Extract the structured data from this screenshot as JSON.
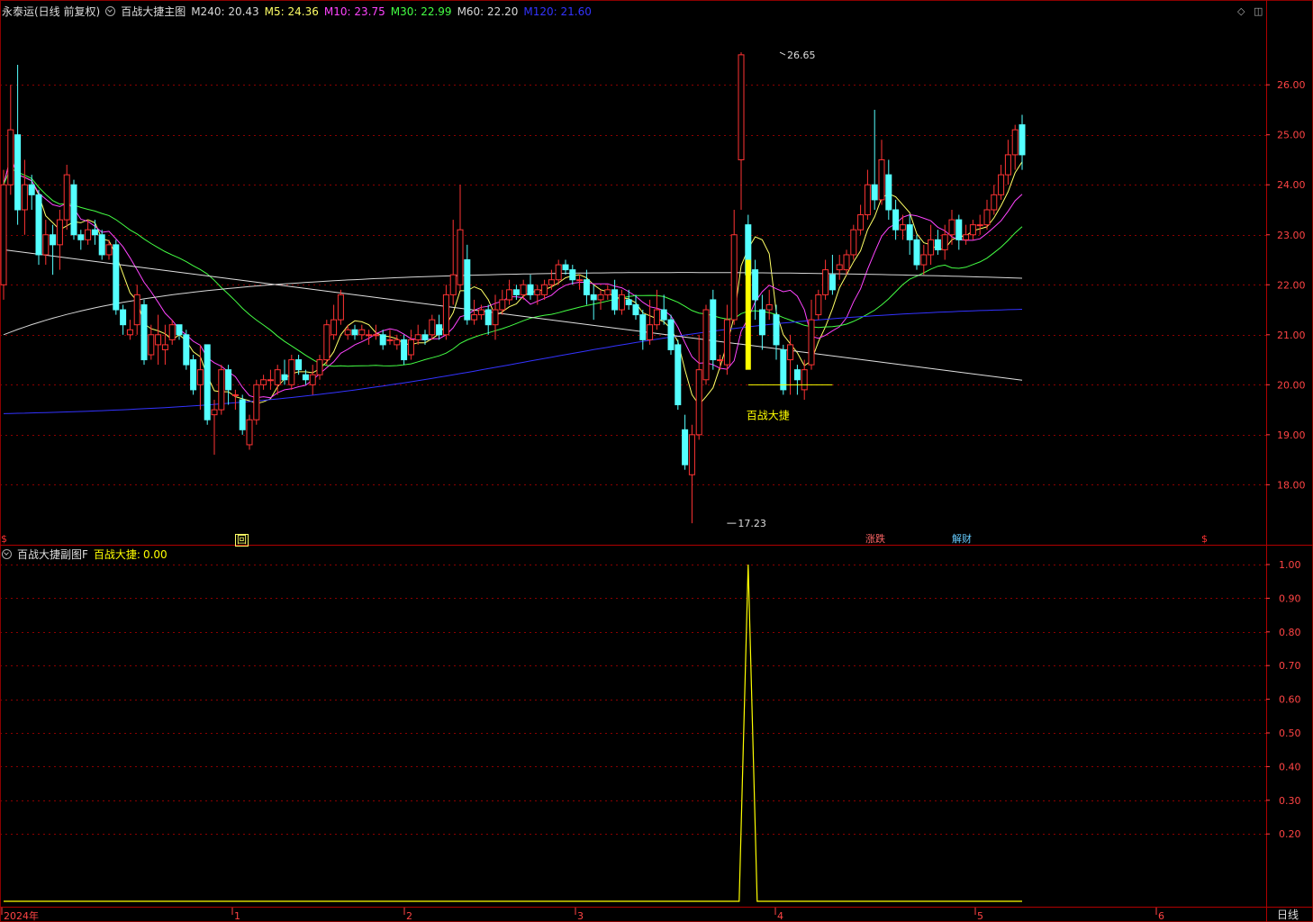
{
  "main_panel": {
    "stock_label": "永泰运(日线 前复权)",
    "indicator_label": "百战大捷主图",
    "ma_readouts": [
      {
        "label": "M240:",
        "value": "20.43",
        "color": "#d8d8d8"
      },
      {
        "label": "M5:",
        "value": "24.36",
        "color": "#ffff66"
      },
      {
        "label": "M10:",
        "value": "23.75",
        "color": "#ff44ff"
      },
      {
        "label": "M30:",
        "value": "22.99",
        "color": "#44ff44"
      },
      {
        "label": "M60:",
        "value": "22.20",
        "color": "#d8d8d8"
      },
      {
        "label": "M120:",
        "value": "21.60",
        "color": "#3333ff"
      }
    ],
    "signal_label": "百战大捷",
    "high_label": "26.65",
    "low_label": "17.23"
  },
  "event_tags": [
    {
      "text": "$",
      "color": "#ff3333"
    },
    {
      "text": "回",
      "color": "#ffff66"
    },
    {
      "text": "涨跌",
      "color": "#ff6666"
    },
    {
      "text": "解财",
      "color": "#66ccff"
    },
    {
      "text": "$",
      "color": "#ff3333"
    }
  ],
  "sub_panel": {
    "title": "百战大捷副图F",
    "readout_label": "百战大捷:",
    "readout_value": "0.00"
  },
  "time_axis": {
    "labels": [
      "2024年",
      "1",
      "2",
      "3",
      "4",
      "5",
      "6"
    ],
    "period": "日线"
  },
  "colors": {
    "up": "#ff3333",
    "down": "#54ffff",
    "grid": "#8b0000",
    "axis_text": "#ff4444",
    "signal": "#ffff00"
  },
  "chart_data": [
    {
      "type": "candlestick",
      "title": "百战大捷主图",
      "ylim": [
        16.8,
        27.3
      ],
      "y_ticks": [
        18.0,
        19.0,
        20.0,
        21.0,
        22.0,
        23.0,
        24.0,
        25.0,
        26.0
      ],
      "candles": [
        [
          22.0,
          24.0,
          21.7,
          24.3
        ],
        [
          24.0,
          25.1,
          23.8,
          26.0
        ],
        [
          25.0,
          23.5,
          23.2,
          26.4
        ],
        [
          23.5,
          24.0,
          23.0,
          24.5
        ],
        [
          24.0,
          23.8,
          23.5,
          24.2
        ],
        [
          23.8,
          22.6,
          22.4,
          23.9
        ],
        [
          22.6,
          23.0,
          22.4,
          23.3
        ],
        [
          23.0,
          22.8,
          22.2,
          23.2
        ],
        [
          22.8,
          23.3,
          22.3,
          23.5
        ],
        [
          23.3,
          24.2,
          23.1,
          24.4
        ],
        [
          24.0,
          23.0,
          22.9,
          24.1
        ],
        [
          23.0,
          22.9,
          22.7,
          23.1
        ],
        [
          22.9,
          23.1,
          22.8,
          23.3
        ],
        [
          23.1,
          23.0,
          22.8,
          23.3
        ],
        [
          23.0,
          22.6,
          22.5,
          23.1
        ],
        [
          22.6,
          22.8,
          22.5,
          22.9
        ],
        [
          22.8,
          21.5,
          21.4,
          22.9
        ],
        [
          21.5,
          21.2,
          21.0,
          21.6
        ],
        [
          21.0,
          21.1,
          20.9,
          21.3
        ],
        [
          21.2,
          21.8,
          21.0,
          22.0
        ],
        [
          21.6,
          20.5,
          20.4,
          21.7
        ],
        [
          20.6,
          21.0,
          20.5,
          21.2
        ],
        [
          20.8,
          21.0,
          20.4,
          21.4
        ],
        [
          20.7,
          20.8,
          20.4,
          21.2
        ],
        [
          20.9,
          21.2,
          20.8,
          21.3
        ],
        [
          21.2,
          21.0,
          20.9,
          21.2
        ],
        [
          21.0,
          20.4,
          20.3,
          21.1
        ],
        [
          20.5,
          19.9,
          19.8,
          20.6
        ],
        [
          20.0,
          20.3,
          19.5,
          20.8
        ],
        [
          20.8,
          19.3,
          19.2,
          20.8
        ],
        [
          19.4,
          19.5,
          18.6,
          19.7
        ],
        [
          19.5,
          20.3,
          19.4,
          20.4
        ],
        [
          20.3,
          19.9,
          19.6,
          20.4
        ],
        [
          19.8,
          19.8,
          19.5,
          19.9
        ],
        [
          19.7,
          19.1,
          19.0,
          19.8
        ],
        [
          18.8,
          19.3,
          18.7,
          19.4
        ],
        [
          19.3,
          20.0,
          19.2,
          20.1
        ],
        [
          20.0,
          20.1,
          19.9,
          20.2
        ],
        [
          20.1,
          20.1,
          19.9,
          20.3
        ],
        [
          20.0,
          20.3,
          19.8,
          20.4
        ],
        [
          20.2,
          20.1,
          20.0,
          20.5
        ],
        [
          20.0,
          20.5,
          19.9,
          20.6
        ],
        [
          20.5,
          20.3,
          20.2,
          20.6
        ],
        [
          20.2,
          20.1,
          20.0,
          20.3
        ],
        [
          20.0,
          20.2,
          19.8,
          20.4
        ],
        [
          20.2,
          20.5,
          20.1,
          20.6
        ],
        [
          20.5,
          21.2,
          20.4,
          21.3
        ],
        [
          21.0,
          21.3,
          20.9,
          21.6
        ],
        [
          21.3,
          21.8,
          21.2,
          21.9
        ],
        [
          21.0,
          21.1,
          20.9,
          21.2
        ],
        [
          21.1,
          21.0,
          20.9,
          21.2
        ],
        [
          21.0,
          21.1,
          20.9,
          21.2
        ],
        [
          21.0,
          21.0,
          20.8,
          21.1
        ],
        [
          21.0,
          21.0,
          20.9,
          21.2
        ],
        [
          21.0,
          20.8,
          20.7,
          21.1
        ],
        [
          20.9,
          20.9,
          20.8,
          21.1
        ],
        [
          20.8,
          20.9,
          20.7,
          21.0
        ],
        [
          20.9,
          20.5,
          20.4,
          21.0
        ],
        [
          20.6,
          20.9,
          20.5,
          21.1
        ],
        [
          20.9,
          21.0,
          20.8,
          21.2
        ],
        [
          21.0,
          20.9,
          20.8,
          21.1
        ],
        [
          21.0,
          21.3,
          20.9,
          21.4
        ],
        [
          21.2,
          21.0,
          20.9,
          21.4
        ],
        [
          21.0,
          21.8,
          20.9,
          22.0
        ],
        [
          21.8,
          22.2,
          21.6,
          23.3
        ],
        [
          22.0,
          23.1,
          21.9,
          24.0
        ],
        [
          22.5,
          21.3,
          21.2,
          22.8
        ],
        [
          21.3,
          21.4,
          21.2,
          21.7
        ],
        [
          21.4,
          21.5,
          21.3,
          21.6
        ],
        [
          21.5,
          21.2,
          21.0,
          21.6
        ],
        [
          21.2,
          21.5,
          20.9,
          21.8
        ],
        [
          21.5,
          21.7,
          21.4,
          21.9
        ],
        [
          21.7,
          21.9,
          21.6,
          22.1
        ],
        [
          21.9,
          21.8,
          21.7,
          22.0
        ],
        [
          21.8,
          22.0,
          21.7,
          22.1
        ],
        [
          22.0,
          21.8,
          21.7,
          22.2
        ],
        [
          21.8,
          21.9,
          21.6,
          22.0
        ],
        [
          21.8,
          22.0,
          21.7,
          22.1
        ],
        [
          22.0,
          22.1,
          21.9,
          22.3
        ],
        [
          22.1,
          22.4,
          22.0,
          22.5
        ],
        [
          22.4,
          22.3,
          22.2,
          22.5
        ],
        [
          22.3,
          22.1,
          22.0,
          22.4
        ],
        [
          22.1,
          22.1,
          21.9,
          22.2
        ],
        [
          22.1,
          21.8,
          21.6,
          22.3
        ],
        [
          21.8,
          21.7,
          21.3,
          22.0
        ],
        [
          21.7,
          21.8,
          21.5,
          21.9
        ],
        [
          21.8,
          21.9,
          21.7,
          22.0
        ],
        [
          21.9,
          21.5,
          21.4,
          22.1
        ],
        [
          21.5,
          21.8,
          21.4,
          21.9
        ],
        [
          21.7,
          21.6,
          21.5,
          21.9
        ],
        [
          21.6,
          21.4,
          21.3,
          21.8
        ],
        [
          21.4,
          20.9,
          20.7,
          21.5
        ],
        [
          20.9,
          21.2,
          20.8,
          21.7
        ],
        [
          21.2,
          21.5,
          21.1,
          21.9
        ],
        [
          21.5,
          21.3,
          21.2,
          21.8
        ],
        [
          21.3,
          20.7,
          20.6,
          21.4
        ],
        [
          20.8,
          19.6,
          19.5,
          20.9
        ],
        [
          19.1,
          18.4,
          18.3,
          19.4
        ],
        [
          18.2,
          19.0,
          17.23,
          19.2
        ],
        [
          19.0,
          20.3,
          18.9,
          21.0
        ],
        [
          20.1,
          21.5,
          20.0,
          21.6
        ],
        [
          21.7,
          20.5,
          20.3,
          21.9
        ],
        [
          20.5,
          20.5,
          20.3,
          20.6
        ],
        [
          20.4,
          21.3,
          20.2,
          21.6
        ],
        [
          21.3,
          23.0,
          21.2,
          23.5
        ],
        [
          24.5,
          26.6,
          23.5,
          26.65
        ],
        [
          23.2,
          22.2,
          21.9,
          23.4
        ],
        [
          22.3,
          21.7,
          21.3,
          22.5
        ],
        [
          21.5,
          21.0,
          20.7,
          21.8
        ],
        [
          21.5,
          21.6,
          21.3,
          21.9
        ],
        [
          21.4,
          20.8,
          20.5,
          21.6
        ],
        [
          20.7,
          19.9,
          19.8,
          20.8
        ],
        [
          20.5,
          20.8,
          19.8,
          21.0
        ],
        [
          20.3,
          20.1,
          19.8,
          20.4
        ],
        [
          19.9,
          20.3,
          19.7,
          20.5
        ],
        [
          20.4,
          21.3,
          20.3,
          21.7
        ],
        [
          21.4,
          21.8,
          21.3,
          21.9
        ],
        [
          21.8,
          22.3,
          21.7,
          22.5
        ],
        [
          22.2,
          21.9,
          21.8,
          22.6
        ],
        [
          22.3,
          22.4,
          22.1,
          22.6
        ],
        [
          22.3,
          22.6,
          22.2,
          22.7
        ],
        [
          22.6,
          23.1,
          22.5,
          23.2
        ],
        [
          23.1,
          23.4,
          23.0,
          23.6
        ],
        [
          23.4,
          24.0,
          23.3,
          24.3
        ],
        [
          24.0,
          23.7,
          23.5,
          25.5
        ],
        [
          23.7,
          24.5,
          23.6,
          24.9
        ],
        [
          24.2,
          23.5,
          23.3,
          24.5
        ],
        [
          23.5,
          23.1,
          22.9,
          23.7
        ],
        [
          23.1,
          23.2,
          22.9,
          23.4
        ],
        [
          23.2,
          22.9,
          22.6,
          23.4
        ],
        [
          22.9,
          22.4,
          22.3,
          23.0
        ],
        [
          22.4,
          22.6,
          22.2,
          22.8
        ],
        [
          22.6,
          22.9,
          22.4,
          23.2
        ],
        [
          22.9,
          22.7,
          22.6,
          23.1
        ],
        [
          22.7,
          23.0,
          22.5,
          23.2
        ],
        [
          23.0,
          23.3,
          22.8,
          23.5
        ],
        [
          23.3,
          22.9,
          22.7,
          23.4
        ],
        [
          22.9,
          23.0,
          22.8,
          23.2
        ],
        [
          23.0,
          23.2,
          22.9,
          23.3
        ],
        [
          23.2,
          23.2,
          23.0,
          23.4
        ],
        [
          23.2,
          23.5,
          23.1,
          23.7
        ],
        [
          23.5,
          23.8,
          23.4,
          24.0
        ],
        [
          23.8,
          24.2,
          23.7,
          24.4
        ],
        [
          24.2,
          24.6,
          24.0,
          24.9
        ],
        [
          24.6,
          25.1,
          24.3,
          25.2
        ],
        [
          25.2,
          24.6,
          24.3,
          25.4
        ]
      ],
      "signal": {
        "bar_index": 106,
        "from": 20.3,
        "to": 22.5,
        "base_line": 20.0,
        "base_line_end_index": 118,
        "label": "百战大捷"
      },
      "extremes": {
        "high": 26.65,
        "high_index": 110,
        "low": 17.23,
        "low_index": 103
      }
    },
    {
      "type": "line",
      "title": "百战大捷副图F",
      "ylim": [
        0,
        1.0
      ],
      "y_ticks": [
        0.2,
        0.3,
        0.4,
        0.5,
        0.6,
        0.7,
        0.8,
        0.9,
        1.0
      ],
      "series": [
        {
          "name": "百战大捷",
          "color": "#ffff00",
          "spike_index": 106,
          "spike_value": 1.0,
          "baseline": 0.0
        }
      ]
    }
  ]
}
